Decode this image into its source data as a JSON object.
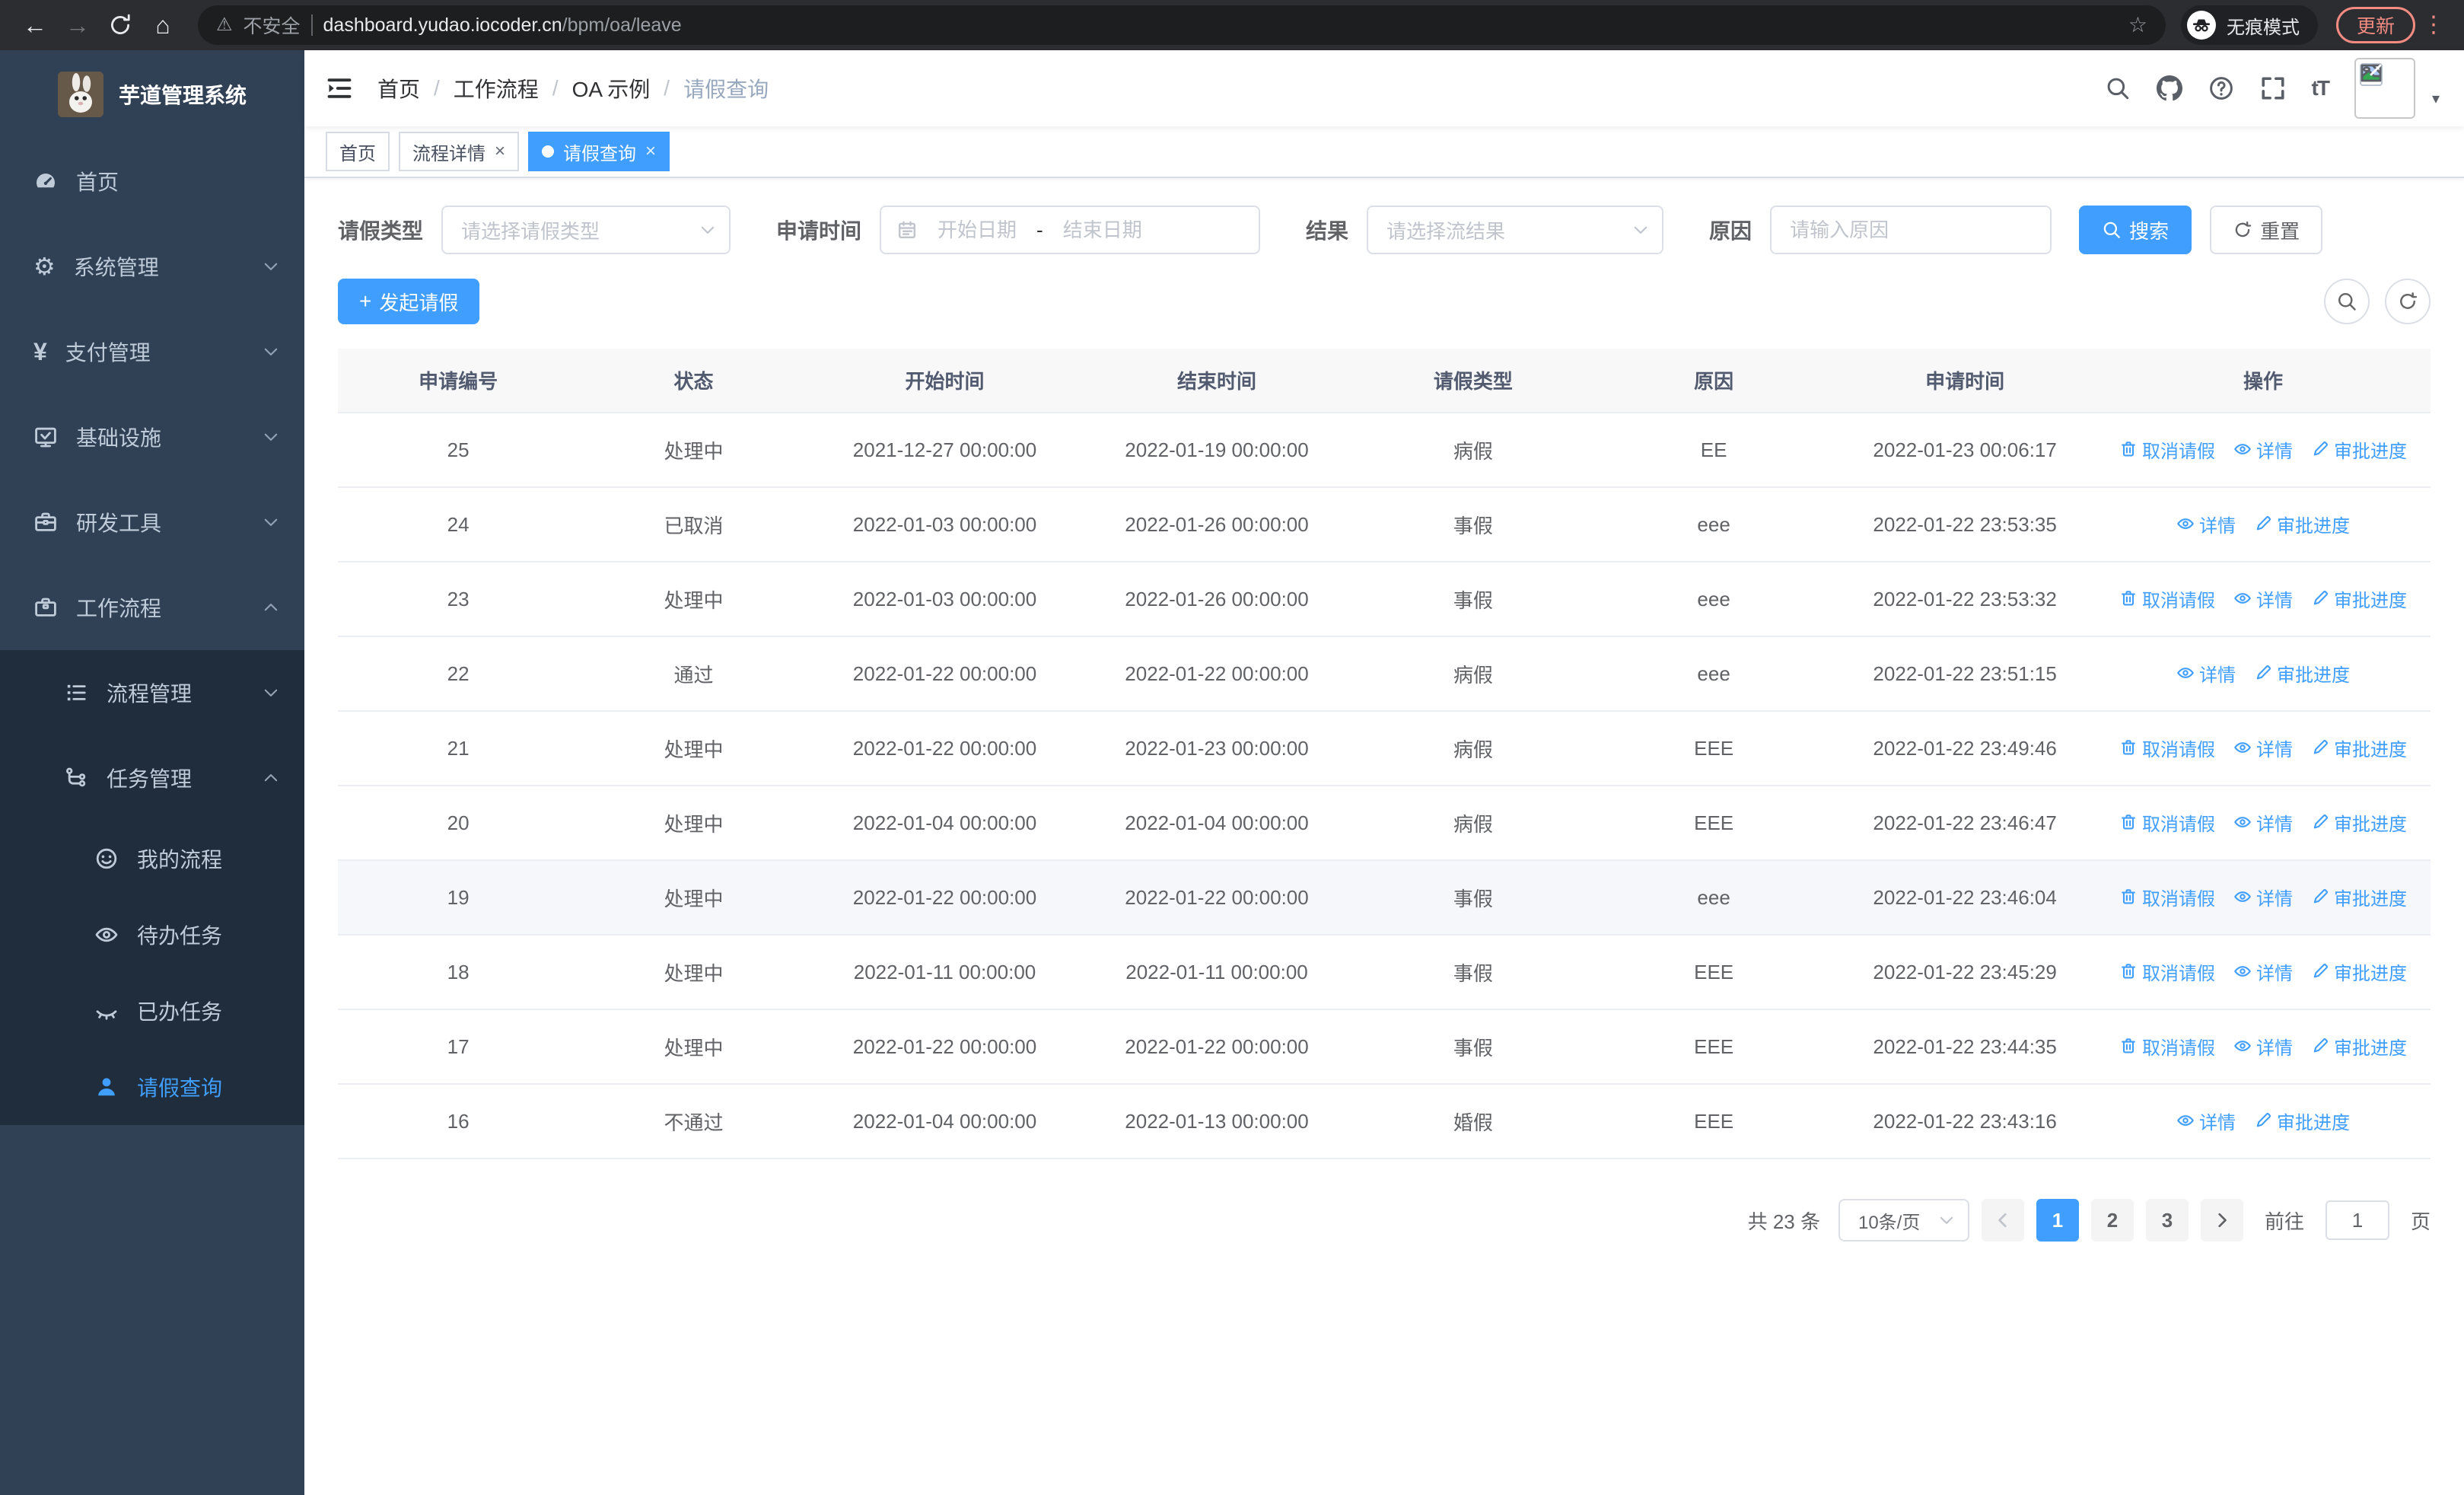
{
  "colors": {
    "accent": "#409eff",
    "sidebar_bg": "#304156",
    "submenu_bg": "#1f2d3d",
    "update": "#f28b82",
    "table_header_bg": "#f8f8f9"
  },
  "browser": {
    "security_label": "不安全",
    "url_host": "dashboard.yudao.iocoder.cn",
    "url_path": "/bpm/oa/leave",
    "incognito_label": "无痕模式",
    "update_label": "更新"
  },
  "sidebar": {
    "title": "芋道管理系统",
    "menu": [
      {
        "id": "home",
        "icon": "dashboard-icon",
        "label": "首页",
        "level": 1
      },
      {
        "id": "system-mgmt",
        "icon": "gear-icon",
        "label": "系统管理",
        "level": 1,
        "arrow": "down"
      },
      {
        "id": "pay-mgmt",
        "icon": "yen-icon",
        "label": "支付管理",
        "level": 1,
        "arrow": "down"
      },
      {
        "id": "infrastructure",
        "icon": "monitor-icon",
        "label": "基础设施",
        "level": 1,
        "arrow": "down"
      },
      {
        "id": "dev-tools",
        "icon": "toolbox-icon",
        "label": "研发工具",
        "level": 1,
        "arrow": "down"
      },
      {
        "id": "workflow",
        "icon": "briefcase-icon",
        "label": "工作流程",
        "level": 1,
        "arrow": "up",
        "children": [
          {
            "id": "process-mgmt",
            "icon": "list-icon",
            "label": "流程管理",
            "level": 2,
            "arrow": "down"
          },
          {
            "id": "task-mgmt",
            "icon": "tree-icon",
            "label": "任务管理",
            "level": 2,
            "arrow": "up",
            "children": [
              {
                "id": "my-process",
                "icon": "face-icon",
                "label": "我的流程",
                "level": 3
              },
              {
                "id": "todo-task",
                "icon": "eye-icon",
                "label": "待办任务",
                "level": 3
              },
              {
                "id": "done-task",
                "icon": "eye-closed-icon",
                "label": "已办任务",
                "level": 3
              },
              {
                "id": "leave-query",
                "icon": "user-icon",
                "label": "请假查询",
                "level": 3,
                "active": true
              }
            ]
          }
        ]
      }
    ]
  },
  "header": {
    "breadcrumbs": [
      "首页",
      "工作流程",
      "OA 示例",
      "请假查询"
    ]
  },
  "tabs": [
    {
      "id": "home",
      "label": "首页",
      "closable": false,
      "active": false
    },
    {
      "id": "process-detail",
      "label": "流程详情",
      "closable": true,
      "active": false
    },
    {
      "id": "leave-query",
      "label": "请假查询",
      "closable": true,
      "active": true
    }
  ],
  "filters": {
    "leave_type_label": "请假类型",
    "leave_type_placeholder": "请选择请假类型",
    "apply_time_label": "申请时间",
    "date_start_placeholder": "开始日期",
    "date_separator": "-",
    "date_end_placeholder": "结束日期",
    "result_label": "结果",
    "result_placeholder": "请选择流结果",
    "reason_label": "原因",
    "reason_placeholder": "请输入原因",
    "search_label": "搜索",
    "reset_label": "重置"
  },
  "toolbar": {
    "create_label": "发起请假"
  },
  "table": {
    "columns": [
      "申请编号",
      "状态",
      "开始时间",
      "结束时间",
      "请假类型",
      "原因",
      "申请时间",
      "操作"
    ],
    "col_widths": [
      "11.5%",
      "11%",
      "13%",
      "13%",
      "11.5%",
      "11.5%",
      "12.5%",
      "16%"
    ],
    "action_defs": {
      "cancel": {
        "label": "取消请假",
        "icon": "trash-icon",
        "name": "cancel-leave-link"
      },
      "view": {
        "label": "详情",
        "icon": "view-icon",
        "name": "detail-link"
      },
      "progress": {
        "label": "审批进度",
        "icon": "edit-icon",
        "name": "approval-progress-link"
      }
    },
    "rows": [
      {
        "id": "25",
        "status": "处理中",
        "start": "2021-12-27 00:00:00",
        "end": "2022-01-19 00:00:00",
        "type": "病假",
        "reason": "EE",
        "applied": "2022-01-23 00:06:17",
        "actions": [
          "cancel",
          "view",
          "progress"
        ],
        "highlighted": false
      },
      {
        "id": "24",
        "status": "已取消",
        "start": "2022-01-03 00:00:00",
        "end": "2022-01-26 00:00:00",
        "type": "事假",
        "reason": "eee",
        "applied": "2022-01-22 23:53:35",
        "actions": [
          "view",
          "progress"
        ],
        "highlighted": false
      },
      {
        "id": "23",
        "status": "处理中",
        "start": "2022-01-03 00:00:00",
        "end": "2022-01-26 00:00:00",
        "type": "事假",
        "reason": "eee",
        "applied": "2022-01-22 23:53:32",
        "actions": [
          "cancel",
          "view",
          "progress"
        ],
        "highlighted": false
      },
      {
        "id": "22",
        "status": "通过",
        "start": "2022-01-22 00:00:00",
        "end": "2022-01-22 00:00:00",
        "type": "病假",
        "reason": "eee",
        "applied": "2022-01-22 23:51:15",
        "actions": [
          "view",
          "progress"
        ],
        "highlighted": false
      },
      {
        "id": "21",
        "status": "处理中",
        "start": "2022-01-22 00:00:00",
        "end": "2022-01-23 00:00:00",
        "type": "病假",
        "reason": "EEE",
        "applied": "2022-01-22 23:49:46",
        "actions": [
          "cancel",
          "view",
          "progress"
        ],
        "highlighted": false
      },
      {
        "id": "20",
        "status": "处理中",
        "start": "2022-01-04 00:00:00",
        "end": "2022-01-04 00:00:00",
        "type": "病假",
        "reason": "EEE",
        "applied": "2022-01-22 23:46:47",
        "actions": [
          "cancel",
          "view",
          "progress"
        ],
        "highlighted": false
      },
      {
        "id": "19",
        "status": "处理中",
        "start": "2022-01-22 00:00:00",
        "end": "2022-01-22 00:00:00",
        "type": "事假",
        "reason": "eee",
        "applied": "2022-01-22 23:46:04",
        "actions": [
          "cancel",
          "view",
          "progress"
        ],
        "highlighted": true
      },
      {
        "id": "18",
        "status": "处理中",
        "start": "2022-01-11 00:00:00",
        "end": "2022-01-11 00:00:00",
        "type": "事假",
        "reason": "EEE",
        "applied": "2022-01-22 23:45:29",
        "actions": [
          "cancel",
          "view",
          "progress"
        ],
        "highlighted": false
      },
      {
        "id": "17",
        "status": "处理中",
        "start": "2022-01-22 00:00:00",
        "end": "2022-01-22 00:00:00",
        "type": "事假",
        "reason": "EEE",
        "applied": "2022-01-22 23:44:35",
        "actions": [
          "cancel",
          "view",
          "progress"
        ],
        "highlighted": false
      },
      {
        "id": "16",
        "status": "不通过",
        "start": "2022-01-04 00:00:00",
        "end": "2022-01-13 00:00:00",
        "type": "婚假",
        "reason": "EEE",
        "applied": "2022-01-22 23:43:16",
        "actions": [
          "view",
          "progress"
        ],
        "highlighted": false
      }
    ]
  },
  "pagination": {
    "total_label": "共 23 条",
    "page_size_label": "10条/页",
    "pages": [
      "1",
      "2",
      "3"
    ],
    "active_page": "1",
    "goto_label": "前往",
    "goto_value": "1",
    "page_suffix": "页"
  }
}
